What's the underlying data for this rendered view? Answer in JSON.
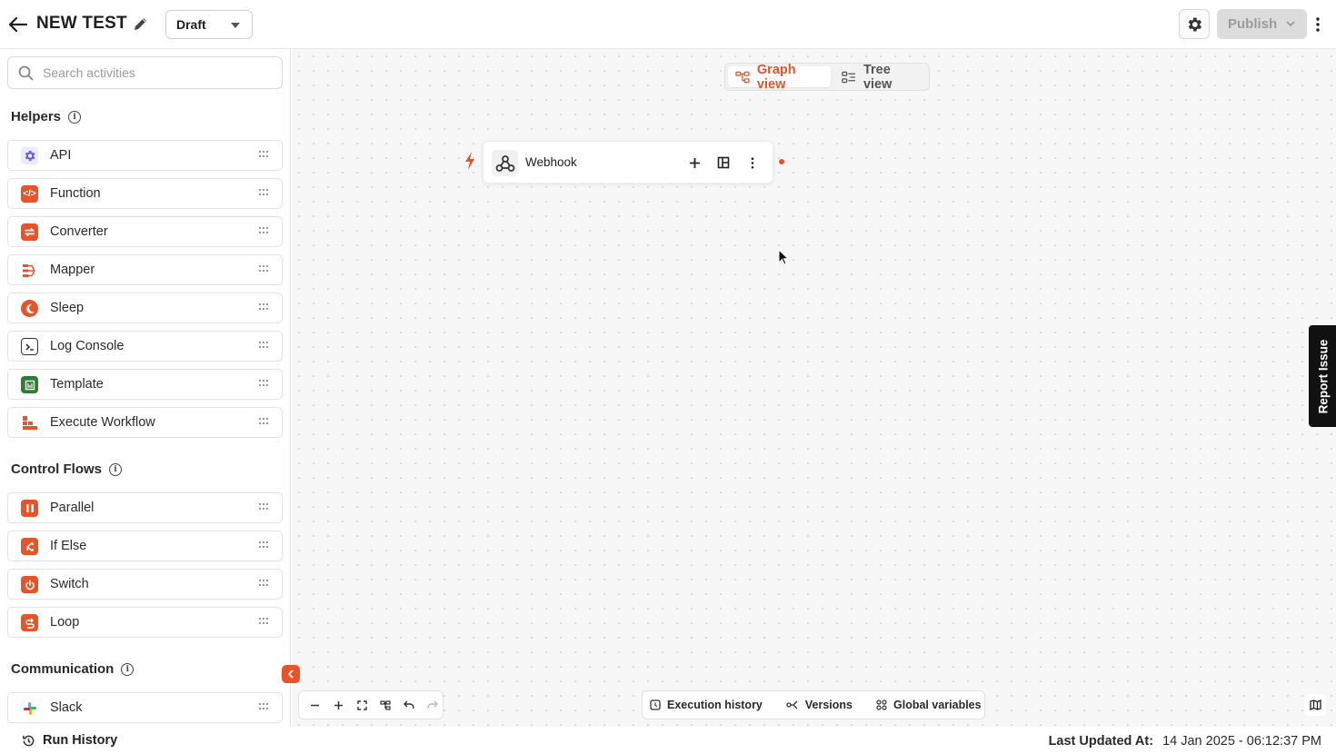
{
  "header": {
    "title": "NEW TEST",
    "status": "Draft",
    "publish_label": "Publish"
  },
  "sidebar": {
    "search_placeholder": "Search activities",
    "sections": [
      {
        "title": "Helpers",
        "items": [
          {
            "label": "API",
            "icon": "api-gear-icon",
            "color": "#6b5fd3"
          },
          {
            "label": "Function",
            "icon": "code-icon",
            "color": "#e8542a"
          },
          {
            "label": "Converter",
            "icon": "convert-icon",
            "color": "#e8542a"
          },
          {
            "label": "Mapper",
            "icon": "mapper-icon",
            "color": "#e8542a"
          },
          {
            "label": "Sleep",
            "icon": "moon-icon",
            "color": "#e8542a"
          },
          {
            "label": "Log Console",
            "icon": "terminal-icon",
            "color": "#333333"
          },
          {
            "label": "Template",
            "icon": "template-icon",
            "color": "#2e7d32"
          },
          {
            "label": "Execute Workflow",
            "icon": "workflow-icon",
            "color": "#e8542a"
          }
        ]
      },
      {
        "title": "Control Flows",
        "items": [
          {
            "label": "Parallel",
            "icon": "parallel-icon",
            "color": "#e8542a"
          },
          {
            "label": "If Else",
            "icon": "branch-icon",
            "color": "#e8542a"
          },
          {
            "label": "Switch",
            "icon": "power-icon",
            "color": "#e8542a"
          },
          {
            "label": "Loop",
            "icon": "loop-icon",
            "color": "#e8542a"
          }
        ]
      },
      {
        "title": "Communication",
        "items": [
          {
            "label": "Slack",
            "icon": "slack-icon",
            "color": "#4a154b"
          }
        ]
      }
    ],
    "run_history": "Run History"
  },
  "canvas": {
    "views": [
      {
        "label": "Graph view",
        "active": true
      },
      {
        "label": "Tree view",
        "active": false
      }
    ],
    "node": {
      "label": "Webhook"
    },
    "report_issue": "Report Issue",
    "bottom_tabs": [
      {
        "label": "Execution history",
        "icon": "history-icon"
      },
      {
        "label": "Versions",
        "icon": "versions-icon"
      },
      {
        "label": "Global variables",
        "icon": "variables-icon"
      }
    ]
  },
  "footer": {
    "last_updated_label": "Last Updated At:",
    "last_updated_value": "14 Jan 2025 - 06:12:37 PM"
  },
  "colors": {
    "accent": "#e8542a",
    "canvas_bg": "#f7f7f7"
  }
}
